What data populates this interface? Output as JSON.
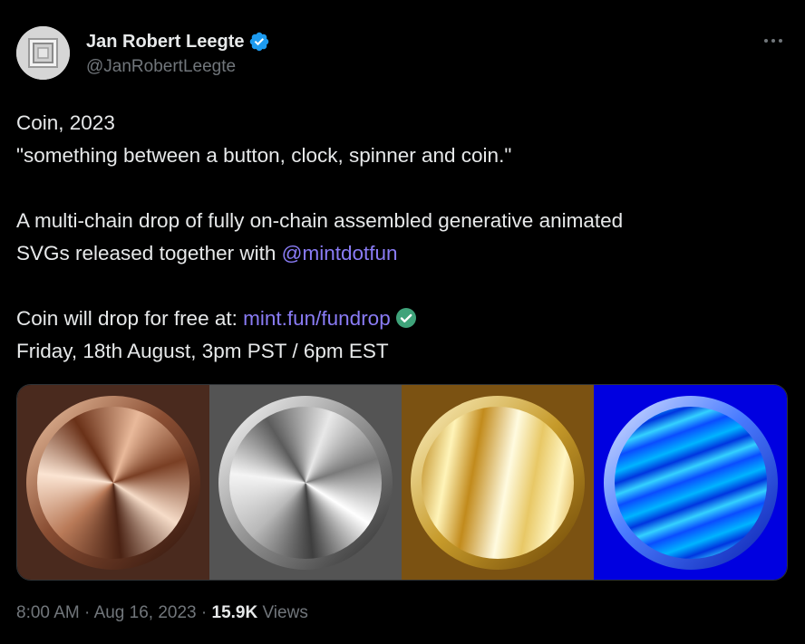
{
  "author": {
    "name": "Jan Robert Leegte",
    "handle": "@JanRobertLeegte",
    "verified": true,
    "avatar_icon": "square-frame-logo"
  },
  "more_icon": "more-horizontal-icon",
  "tweet": {
    "line1": "Coin, 2023",
    "line2": "\"something between a button, clock, spinner and coin.\"",
    "line3": "A multi-chain drop of fully on-chain assembled generative animated",
    "line4_text": "SVGs released together with ",
    "line4_mention": "@mintdotfun",
    "line5_text": "Coin will drop for free at: ",
    "line5_link": "mint.fun/fundrop",
    "line5_check_icon": "green-check-icon",
    "line6": "Friday, 18th August, 3pm PST / 6pm EST"
  },
  "media": {
    "panels": [
      {
        "name": "bronze-coin-image",
        "background": "#4a2a1e"
      },
      {
        "name": "silver-coin-image",
        "background": "#545454"
      },
      {
        "name": "gold-coin-image",
        "background": "#7b5212"
      },
      {
        "name": "blue-coin-image",
        "background": "#0000e0"
      }
    ]
  },
  "footer": {
    "time": "8:00 AM",
    "sep1": " · ",
    "date": "Aug 16, 2023",
    "sep2": " · ",
    "views_count": "15.9K",
    "views_label": " Views"
  },
  "colors": {
    "background": "#000000",
    "text": "#e7e9ea",
    "muted": "#71767b",
    "link": "#8a7cf6",
    "verified_blue": "#1d9bf0",
    "check_green": "#3fa37a"
  }
}
